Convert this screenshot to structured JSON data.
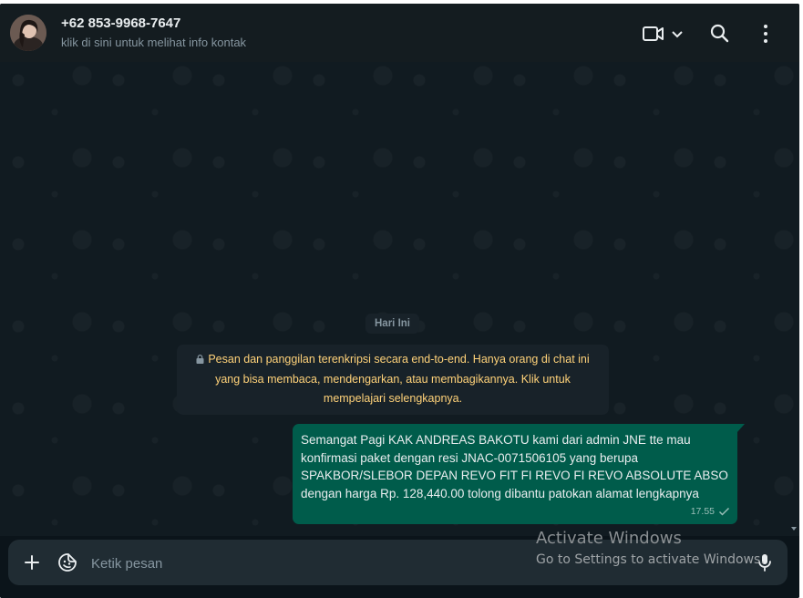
{
  "header": {
    "contact_name": "+62 853-9968-7647",
    "contact_subtitle": "klik di sini untuk melihat info kontak",
    "icons": [
      "video-call-icon",
      "chevron-down-icon",
      "search-icon",
      "kebab-menu-icon"
    ]
  },
  "chat": {
    "date_chip": "Hari Ini",
    "encryption_notice": "Pesan dan panggilan terenkripsi secara end-to-end. Hanya orang di chat ini yang bisa membaca, mendengarkan, atau membagikannya. Klik untuk mempelajari selengkapnya.",
    "messages": [
      {
        "direction": "outgoing",
        "text": "Semangat Pagi KAK ANDREAS BAKOTU kami dari admin JNE tte mau konfirmasi paket dengan resi JNAC-0071506105 yang berupa SPAKBOR/SLEBOR DEPAN REVO FIT FI REVO FI REVO ABSOLUTE ABSO dengan harga Rp. 128,440.00 tolong dibantu patokan alamat lengkapnya",
        "time": "17.55",
        "status": "sent"
      }
    ]
  },
  "composer": {
    "placeholder": "Ketik pesan"
  },
  "watermark": {
    "title": "Activate Windows",
    "subtitle": "Go to Settings to activate Windows."
  },
  "colors": {
    "header_bg": "#141c20",
    "chat_bg": "#111b21",
    "outgoing_bubble": "#005c4b",
    "notice_text": "#ffd279",
    "composer_bg": "#202c33"
  }
}
